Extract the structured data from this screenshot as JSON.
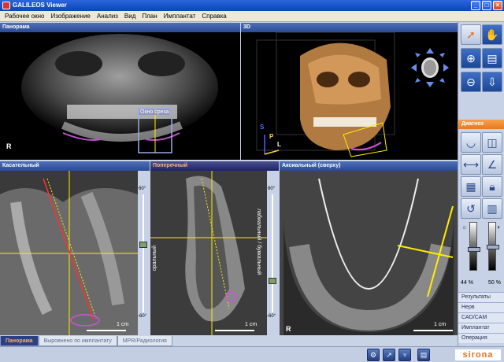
{
  "window": {
    "title": "GALILEOS Viewer",
    "minimize": "_",
    "maximize": "□",
    "close": "×"
  },
  "menu": [
    "Рабочее окно",
    "Изображение",
    "Анализ",
    "Вид",
    "План",
    "Имплантат",
    "Справка"
  ],
  "panels": {
    "panorama": {
      "title": "Панорама",
      "slice_label": "Окно среза",
      "r_label": "R"
    },
    "view3d": {
      "title": "3D",
      "axis_s": "S",
      "axis_p": "P",
      "axis_l": "L"
    },
    "tangential": {
      "title": "Касательный",
      "angle_top": "60°",
      "angle_bottom": "-60°",
      "scale": "1 cm"
    },
    "transverse": {
      "title": "Поперечный",
      "side_left": "оральный",
      "side_right": "лабиальный / буккальный",
      "angle_top": "60°",
      "angle_bottom": "-60°",
      "scale": "1 cm"
    },
    "axial": {
      "title": "Аксиальный (сверху)",
      "r_label": "R",
      "scale": "1 cm"
    }
  },
  "toolbar": {
    "diagnosis": "Диагноз",
    "brightness_value": "44 %",
    "contrast_value": "50 %",
    "brightness_level": 0.44,
    "contrast_level": 0.5,
    "menu": [
      "Результаты",
      "Нерв",
      "CAD/CAM",
      "Имплантат",
      "Операция"
    ]
  },
  "tabs": [
    "Панорама",
    "Выровнено по имплантату",
    "MPR/Радиология"
  ],
  "logo": "sirona",
  "colors": {
    "header": "#2c4a95",
    "active_tab": "#2a3f84",
    "diagnosis": "#e8791c",
    "implant": "#ff3030",
    "guide": "#ffee00"
  }
}
